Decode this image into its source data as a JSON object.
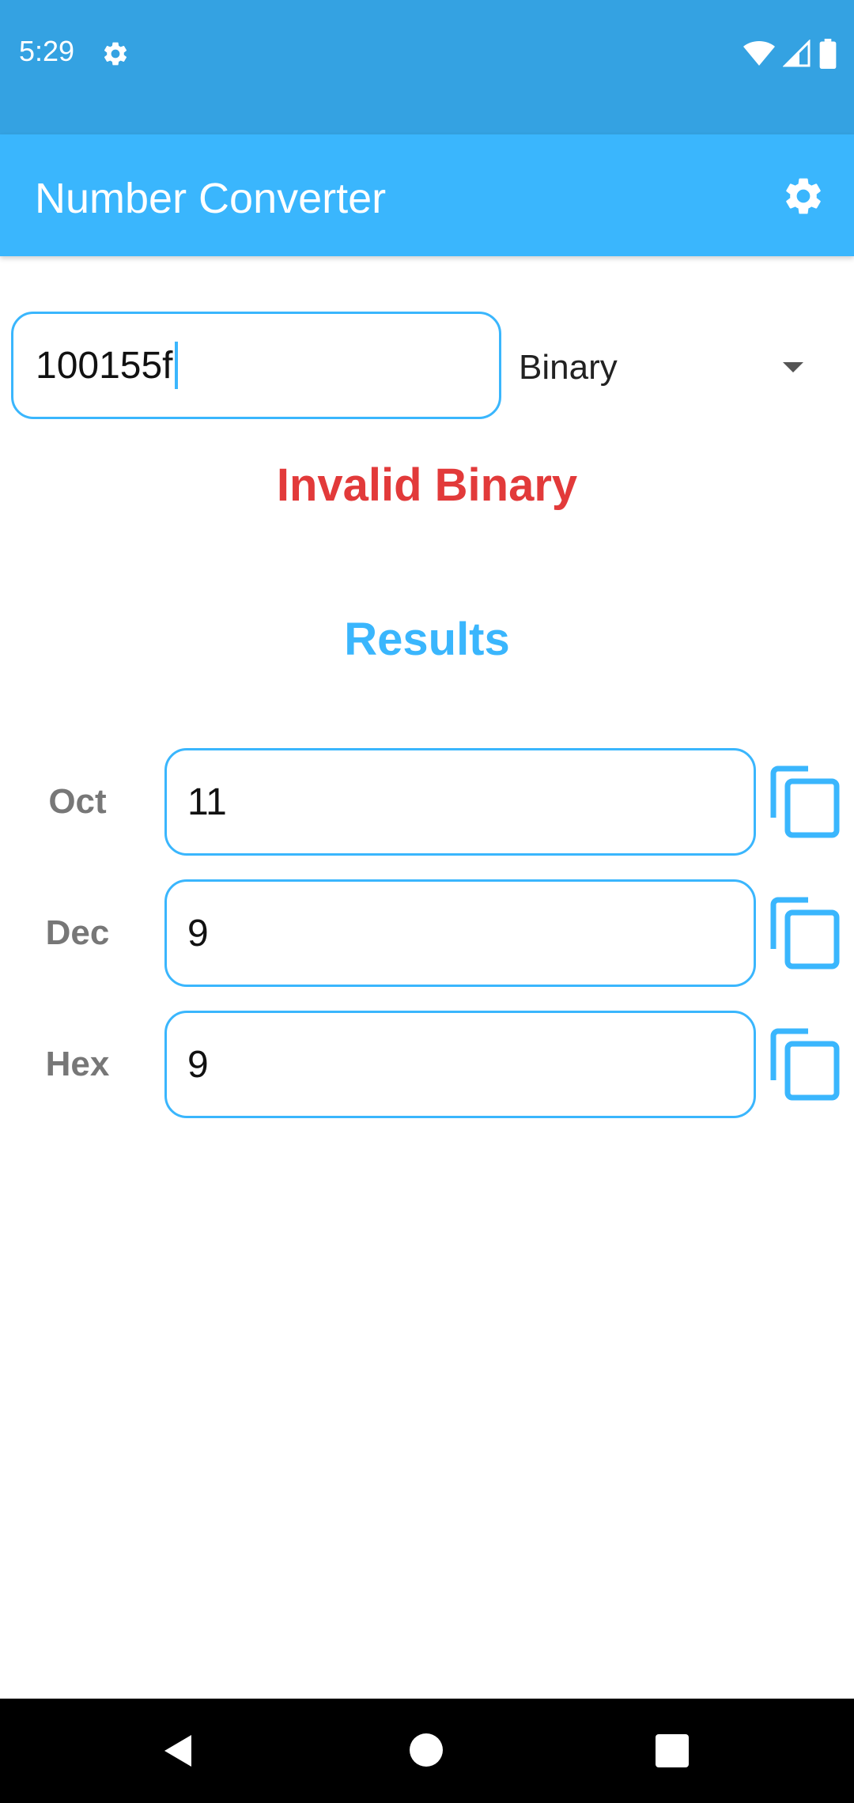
{
  "status_bar": {
    "time": "5:29",
    "icons": [
      "gear-icon",
      "wifi-icon",
      "signal-icon",
      "battery-icon"
    ]
  },
  "app_bar": {
    "title": "Number Converter",
    "settings_icon": "gear-icon"
  },
  "input": {
    "value": "100155f",
    "base_selected": "Binary"
  },
  "error_message": "Invalid Binary",
  "results": {
    "title": "Results",
    "rows": [
      {
        "label": "Oct",
        "value": "11"
      },
      {
        "label": "Dec",
        "value": "9"
      },
      {
        "label": "Hex",
        "value": "9"
      }
    ]
  },
  "colors": {
    "status_bar": "#34a2e2",
    "app_bar": "#3ab6fd",
    "accent": "#3ab6fd",
    "error": "#e23a3a",
    "label": "#777777"
  }
}
